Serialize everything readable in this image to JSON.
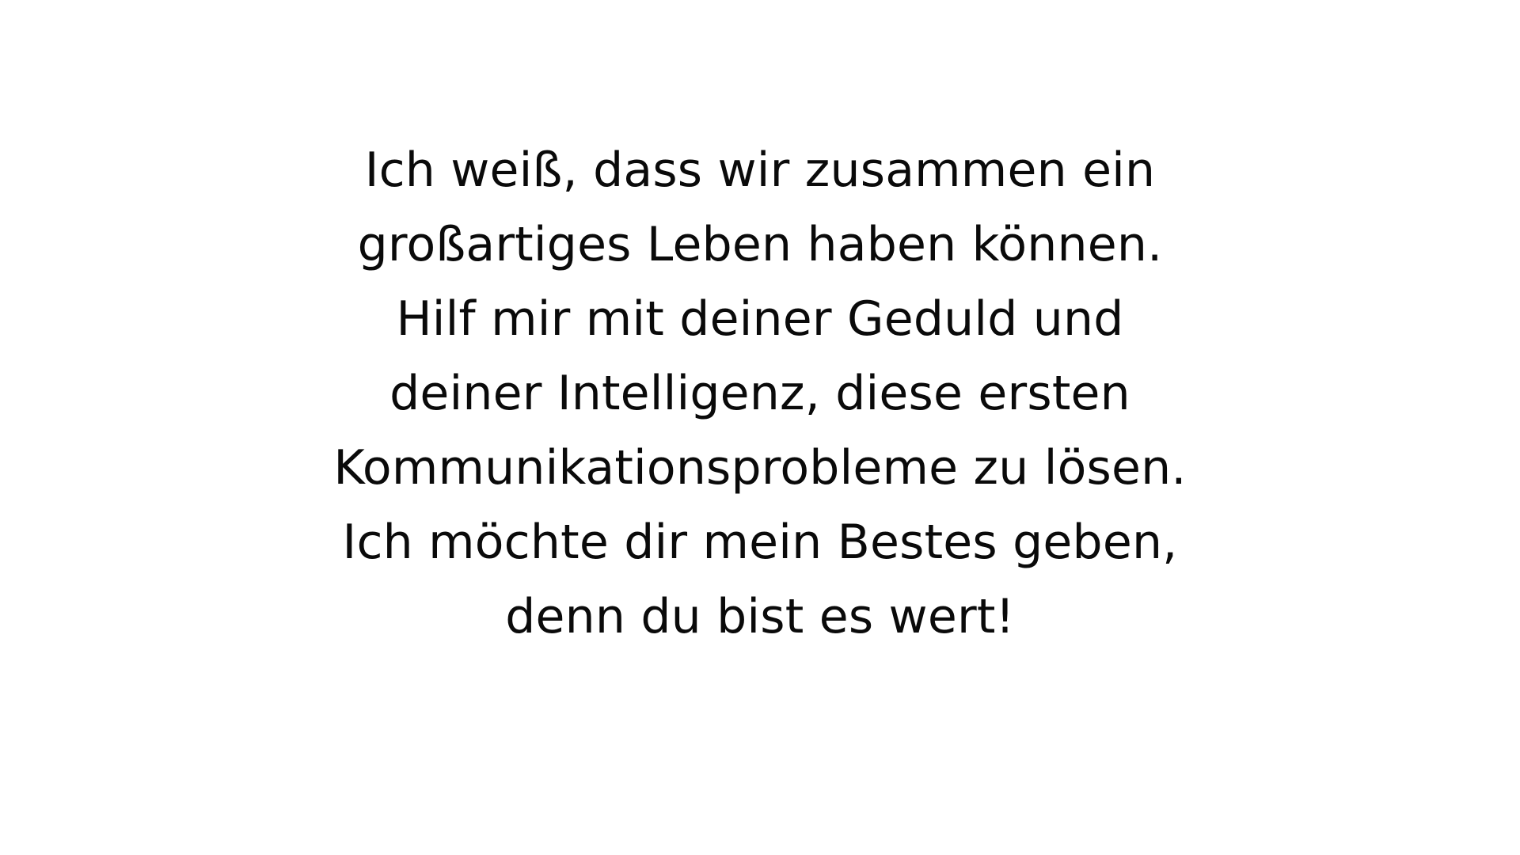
{
  "quote": {
    "lines": [
      "Ich weiß, dass wir zusammen ein",
      "großartiges Leben haben können.",
      "Hilf mir mit deiner Geduld und",
      "deiner Intelligenz, diese ersten",
      "Kommunikationsprobleme zu lösen.",
      "Ich möchte dir mein Bestes geben,",
      "denn du bist es wert!"
    ]
  },
  "colors": {
    "background": "#ffffff",
    "text": "#0a0a0a"
  }
}
